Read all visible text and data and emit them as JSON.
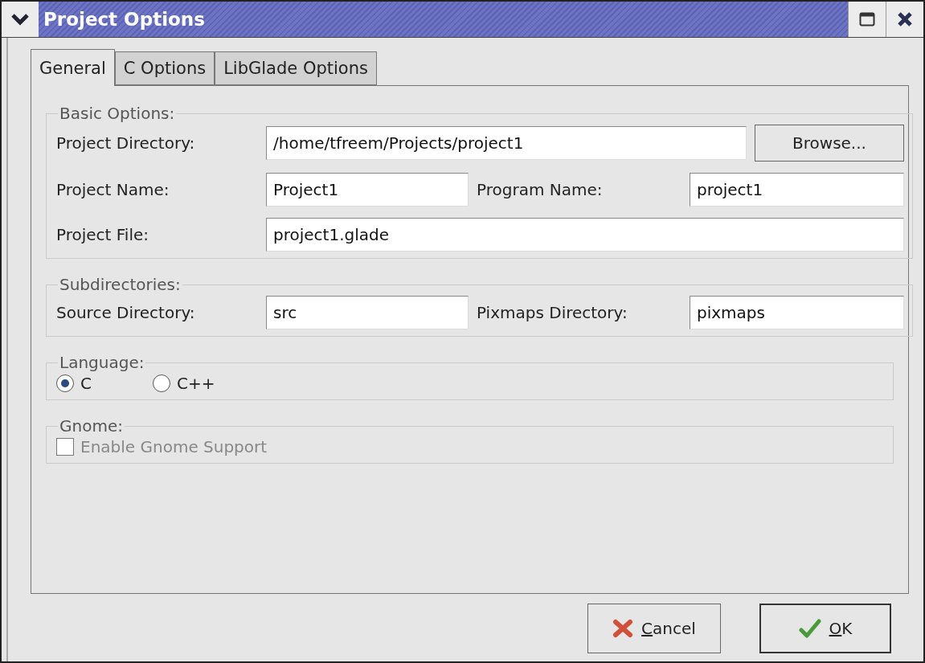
{
  "window": {
    "title": "Project Options"
  },
  "tabs": [
    {
      "label": "General",
      "selected": true
    },
    {
      "label": "C Options",
      "selected": false
    },
    {
      "label": "LibGlade Options",
      "selected": false
    }
  ],
  "basic_options": {
    "title": "Basic Options:",
    "project_directory": {
      "label": "Project Directory:",
      "value": "/home/tfreem/Projects/project1"
    },
    "browse_button": "Browse...",
    "project_name": {
      "label": "Project Name:",
      "value": "Project1"
    },
    "program_name": {
      "label": "Program Name:",
      "value": "project1"
    },
    "project_file": {
      "label": "Project File:",
      "value": "project1.glade"
    }
  },
  "subdirectories": {
    "title": "Subdirectories:",
    "source_directory": {
      "label": "Source Directory:",
      "value": "src"
    },
    "pixmaps_directory": {
      "label": "Pixmaps Directory:",
      "value": "pixmaps"
    }
  },
  "language": {
    "title": "Language:",
    "options": [
      {
        "label": "C",
        "selected": true
      },
      {
        "label": "C++",
        "selected": false
      }
    ]
  },
  "gnome": {
    "title": "Gnome:",
    "enable_gnome_support": {
      "label": "Enable Gnome Support",
      "checked": false,
      "disabled": true
    }
  },
  "buttons": [
    {
      "label": "Cancel",
      "kind": "cancel"
    },
    {
      "label": "OK",
      "kind": "ok"
    }
  ]
}
